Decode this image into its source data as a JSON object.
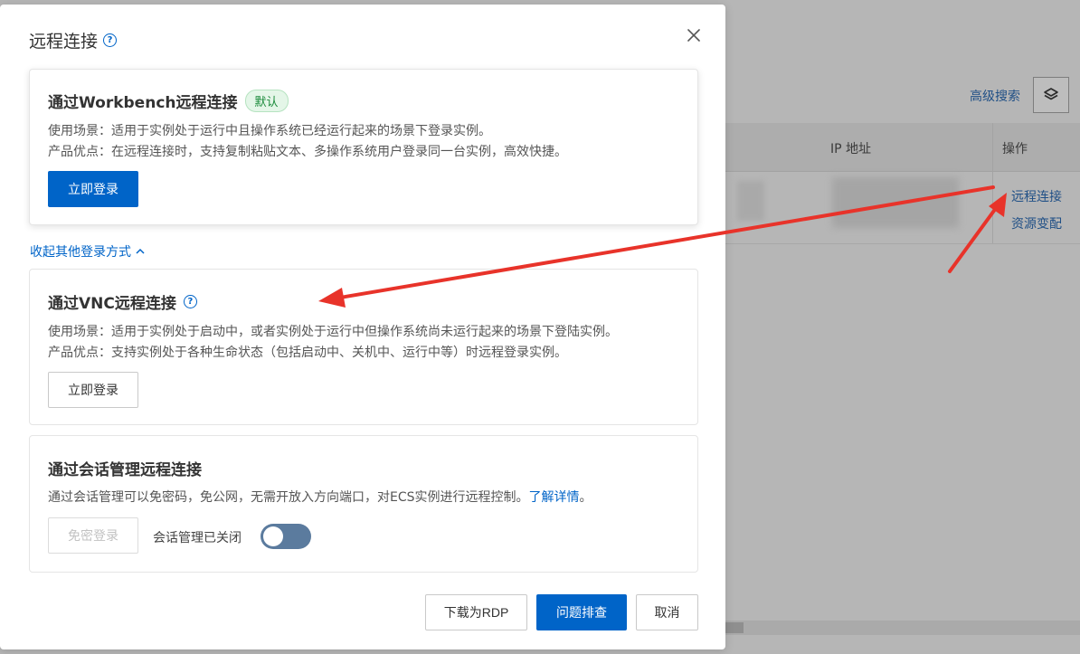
{
  "background": {
    "advanced_search": "高级搜索",
    "col_ip": "IP 地址",
    "col_actions": "操作",
    "row_link_remote": "远程连接",
    "row_link_resize": "资源变配"
  },
  "modal": {
    "title": "远程连接",
    "workbench": {
      "title": "通过Workbench远程连接",
      "badge": "默认",
      "scenario": "使用场景：适用于实例处于运行中且操作系统已经运行起来的场景下登录实例。",
      "advantage": "产品优点：在远程连接时，支持复制粘贴文本、多操作系统用户登录同一台实例，高效快捷。",
      "login_button": "立即登录"
    },
    "collapse_link": "收起其他登录方式",
    "vnc": {
      "title": "通过VNC远程连接",
      "scenario": "使用场景：适用于实例处于启动中，或者实例处于运行中但操作系统尚未运行起来的场景下登陆实例。",
      "advantage": "产品优点：支持实例处于各种生命状态（包括启动中、关机中、运行中等）时远程登录实例。",
      "login_button": "立即登录"
    },
    "session": {
      "title": "通过会话管理远程连接",
      "description": "通过会话管理可以免密码，免公网，无需开放入方向端口，对ECS实例进行远程控制。",
      "learn_more": "了解详情",
      "learn_more_suffix": "。",
      "passwordless_button": "免密登录",
      "toggle_label": "会话管理已关闭",
      "toggle_on": false
    },
    "footer": {
      "download_rdp": "下载为RDP",
      "troubleshoot": "问题排查",
      "cancel": "取消"
    }
  },
  "colors": {
    "primary": "#0064c8",
    "badge_green": "#1a8a3a",
    "annotation_red": "#e8332a"
  }
}
